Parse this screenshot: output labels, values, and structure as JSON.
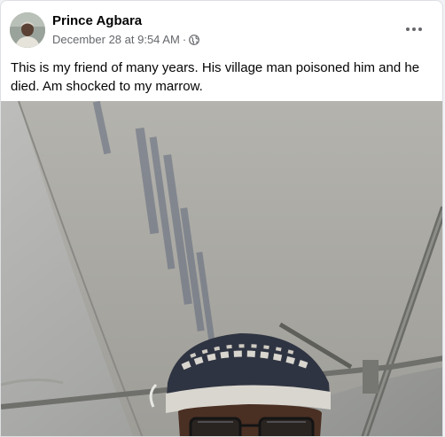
{
  "post": {
    "author": "Prince Agbara",
    "timestamp": "December 28 at 9:54 AM",
    "separator": "·",
    "caption": "This is my friend of many years. His village man poisoned him and he died. Am shocked to my marrow.",
    "privacy_icon": "globe-icon",
    "menu_icon": "more-options-icon",
    "photo": {
      "description_icon": "post-photo"
    }
  },
  "colors": {
    "name": "#050505",
    "meta": "#65676b",
    "background": "#ffffff",
    "page": "#f0f2f5"
  }
}
